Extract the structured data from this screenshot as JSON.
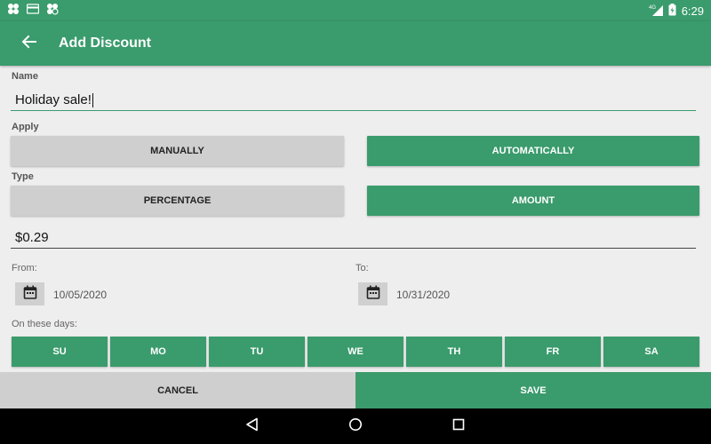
{
  "status_bar": {
    "left_icons": [
      "clover-icon",
      "card-icon",
      "clover-icon"
    ],
    "network": "4G",
    "time": "6:29"
  },
  "toolbar": {
    "title": "Add Discount",
    "back_icon": "arrow-left-icon"
  },
  "form": {
    "name_label": "Name",
    "name_value": "Holiday sale!",
    "apply_label": "Apply",
    "apply_options": [
      "MANUALLY",
      "AUTOMATICALLY"
    ],
    "apply_selected": "AUTOMATICALLY",
    "type_label": "Type",
    "type_options": [
      "PERCENTAGE",
      "AMOUNT"
    ],
    "type_selected": "AMOUNT",
    "amount_value": "$0.29",
    "from_label": "From:",
    "from_date": "10/05/2020",
    "to_label": "To:",
    "to_date": "10/31/2020",
    "days_label": "On these days:",
    "days": [
      "SU",
      "MO",
      "TU",
      "WE",
      "TH",
      "FR",
      "SA"
    ]
  },
  "actions": {
    "cancel_label": "CANCEL",
    "save_label": "SAVE"
  },
  "colors": {
    "accent": "#3a9b6c",
    "button_grey": "#cfcfcf",
    "background": "#eeeeee"
  }
}
